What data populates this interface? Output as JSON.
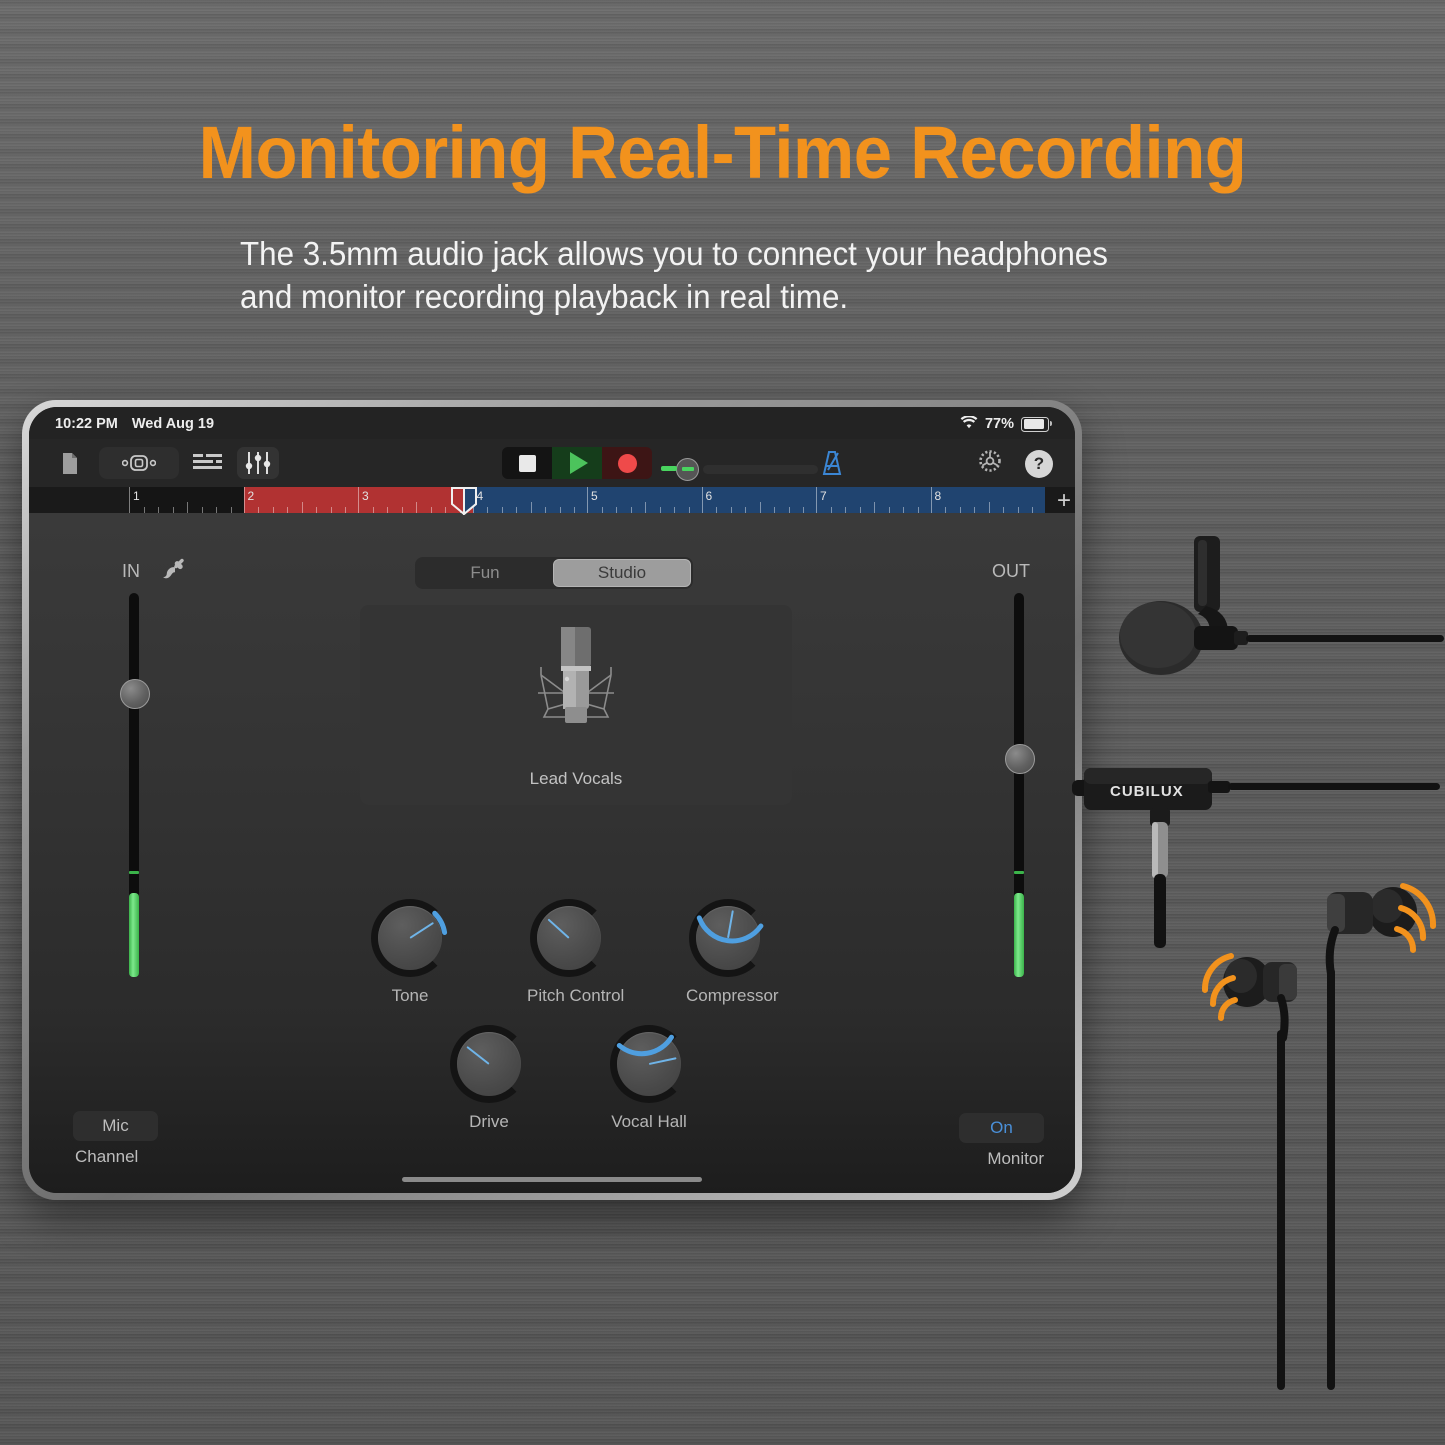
{
  "promo": {
    "headline": "Monitoring Real-Time Recording",
    "subcopy_line1": "The 3.5mm audio jack allows you to connect your headphones",
    "subcopy_line2": "and monitor recording playback in real time.",
    "headline_color": "#F2921D",
    "subcopy_color": "#F3F3F3",
    "background_color": "#5D5D5D"
  },
  "device": {
    "status_bar": {
      "time": "10:22 PM",
      "date": "Wed Aug 19",
      "wifi_icon": "wifi-icon",
      "battery_percent": "77%",
      "battery_icon": "battery-icon"
    },
    "toolbar": {
      "icons": [
        {
          "name": "document-icon",
          "label": "My Songs"
        },
        {
          "name": "loop-browser-icon",
          "label": "Loop Browser"
        },
        {
          "name": "track-view-icon",
          "label": "Tracks View"
        },
        {
          "name": "mixer-icon",
          "label": "Mixer"
        }
      ],
      "transport": {
        "stop_label": "Stop",
        "play_label": "Play",
        "record_label": "Record",
        "stop_icon": "stop-icon",
        "play_icon": "play-icon",
        "record_icon": "record-icon"
      },
      "master_volume": {
        "name": "master-volume-slider",
        "value_percent": 2
      },
      "metronome_icon": "metronome-icon",
      "settings_icon": "gear-icon",
      "help_label": "?"
    },
    "ruler": {
      "bars": [
        "1",
        "2",
        "3",
        "4",
        "5",
        "6",
        "7",
        "8"
      ],
      "dark_section_bars": [
        "1"
      ],
      "red_section_bars": [
        "2",
        "3"
      ],
      "blue_section_bars": [
        "4",
        "5",
        "6",
        "7",
        "8"
      ],
      "playhead_bar_position": 3.88,
      "add_track_label": "+",
      "red_color": "#B13232",
      "blue_color": "#204470",
      "dark_color": "#151515"
    }
  },
  "instrument": {
    "mode_switch": {
      "options": [
        "Fun",
        "Studio"
      ],
      "selected": "Studio"
    },
    "input": {
      "label": "IN",
      "jack_icon": "audio-jack-icon",
      "fader_value_percent": 74,
      "meter_level_percent": 22
    },
    "output": {
      "label": "OUT",
      "fader_value_percent": 57,
      "meter_level_percent": 22
    },
    "patch": {
      "name": "Lead Vocals",
      "icon": "condenser-microphone-icon"
    },
    "knobs": [
      {
        "label": "Tone",
        "angle_deg": 57,
        "arc_start_deg": 45,
        "arc_sweep_deg": 36,
        "arc_from": "top"
      },
      {
        "label": "Pitch Control",
        "angle_deg": -48,
        "arc_start_deg": 0,
        "arc_sweep_deg": 0,
        "arc_from": "none"
      },
      {
        "label": "Compressor",
        "angle_deg": 10,
        "arc_start_deg": -55,
        "arc_sweep_deg": 125,
        "arc_from": "left"
      },
      {
        "label": "Drive",
        "angle_deg": -52,
        "arc_start_deg": 0,
        "arc_sweep_deg": 0,
        "arc_from": "none"
      },
      {
        "label": "Vocal Hall",
        "angle_deg": 78,
        "arc_start_deg": -58,
        "arc_sweep_deg": 98,
        "arc_from": "left"
      }
    ],
    "channel": {
      "value": "Mic",
      "caption": "Channel"
    },
    "monitor": {
      "value": "On",
      "caption": "Monitor",
      "value_color": "#4A90D9"
    }
  },
  "accessories": {
    "lavalier_mic": {
      "name": "lavalier-microphone",
      "has_clip": true,
      "has_windscreen": true
    },
    "adapter": {
      "name": "audio-adapter",
      "brand": "CUBILUX",
      "jack": "3.5mm-jack"
    },
    "earphones": {
      "name": "in-ear-headphones",
      "count": 2,
      "sound_wave_color": "#F2921D"
    }
  }
}
